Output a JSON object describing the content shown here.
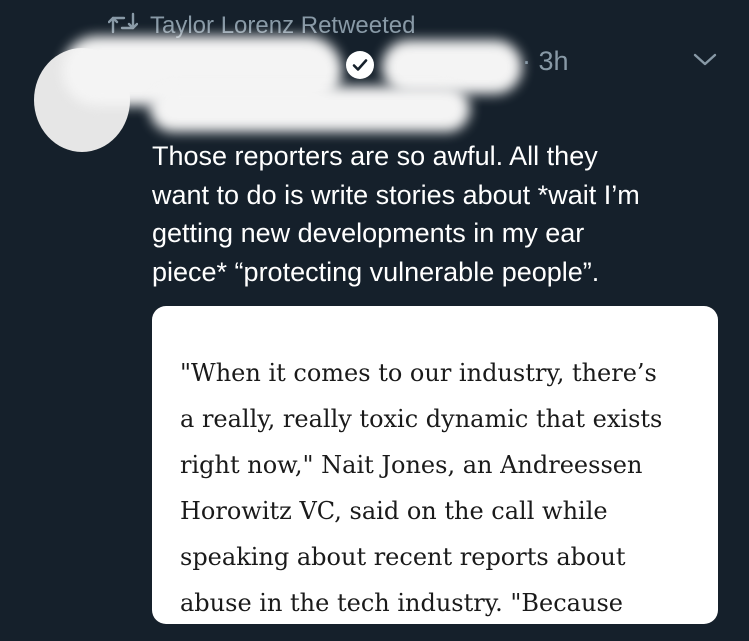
{
  "retweet": {
    "text": "Taylor Lorenz Retweeted",
    "icon": "retweet-icon"
  },
  "tweet": {
    "timestamp": "· 3h",
    "menu_icon": "chevron-down-icon",
    "verified_icon": "verified-badge-icon",
    "text_lines": [
      "Those reporters are so awful. All they",
      "want to do is write stories about *wait I’m",
      "getting new developments in my ear",
      "piece* “protecting vulnerable people”."
    ]
  },
  "quote": {
    "lines": [
      "\"When it comes to our industry, there’s",
      "a really, really toxic dynamic that exists",
      "right now,\" Nait Jones, an Andreessen",
      "Horowitz VC, said on the call while",
      "speaking about recent reports about",
      "abuse in the tech industry. \"Because"
    ]
  },
  "colors": {
    "background": "#15202b",
    "secondary_text": "#8899a6",
    "primary_text": "#ffffff",
    "card_background": "#ffffff"
  }
}
